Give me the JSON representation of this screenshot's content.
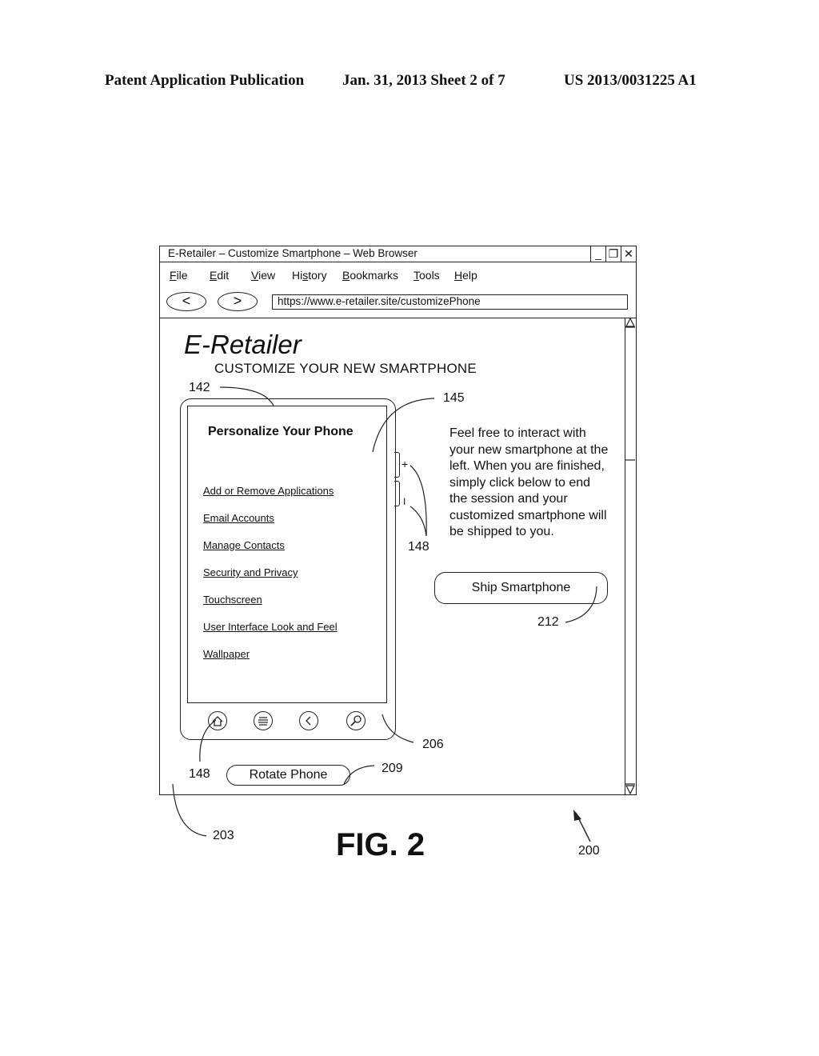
{
  "patent_header": {
    "publication": "Patent Application Publication",
    "date_sheet": "Jan. 31, 2013   Sheet 2 of 7",
    "number": "US 2013/0031225 A1"
  },
  "browser": {
    "title": "E-Retailer – Customize Smartphone – Web Browser",
    "window_controls": {
      "minimize": "_",
      "restore": "❐",
      "close": "✕"
    },
    "menu": [
      {
        "accel": "F",
        "rest": "ile"
      },
      {
        "accel": "E",
        "rest": "dit"
      },
      {
        "accel": "V",
        "rest": "iew"
      },
      {
        "pre": "Hi",
        "accel": "s",
        "rest": "tory"
      },
      {
        "accel": "B",
        "rest": "ookmarks"
      },
      {
        "accel": "T",
        "rest": "ools"
      },
      {
        "accel": "H",
        "rest": "elp"
      }
    ],
    "back_icon": "<",
    "forward_icon": ">",
    "url": "https://www.e-retailer.site/customizePhone"
  },
  "page": {
    "logo": "E-Retailer",
    "subtitle": "CUSTOMIZE YOUR NEW SMARTPHONE",
    "phone": {
      "screen_title": "Personalize Your Phone",
      "links": [
        "Add or Remove Applications",
        "Email Accounts",
        "Manage Contacts",
        "Security and Privacy",
        "Touchscreen",
        "User Interface Look and Feel",
        "Wallpaper"
      ],
      "side_buttons": {
        "volume_up": "+",
        "volume_down": "I"
      },
      "nav_buttons": [
        "home-icon",
        "menu-icon",
        "back-icon",
        "search-icon"
      ]
    },
    "info_text": "Feel free to interact with your new smartphone at the left.  When you are finished, simply click below to end the session and your customized smartphone will be shipped to you.",
    "ship_button": "Ship Smartphone",
    "rotate_button": "Rotate Phone"
  },
  "reference_numerals": {
    "r142": "142",
    "r145": "145",
    "r148_side": "148",
    "r148_home": "148",
    "r212": "212",
    "r206": "206",
    "r209": "209",
    "r203": "203",
    "r200": "200"
  },
  "figure_label": "FIG. 2"
}
